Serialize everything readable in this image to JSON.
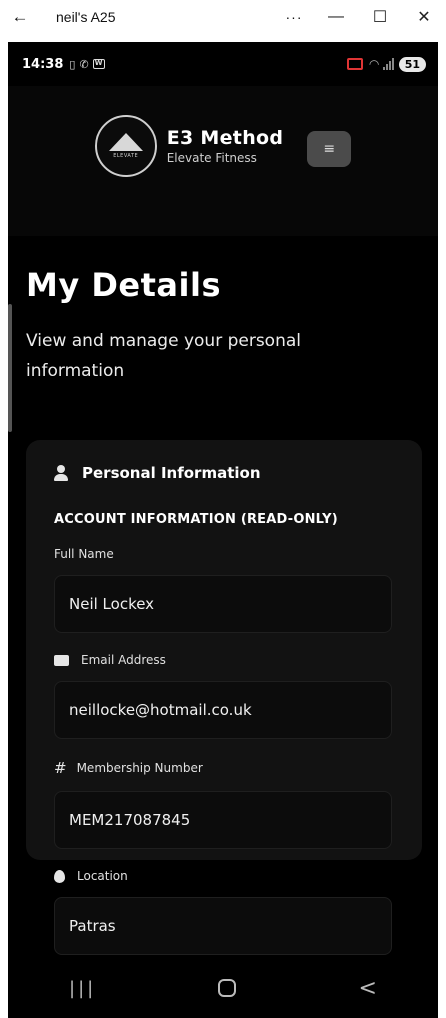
{
  "window": {
    "back_glyph": "←",
    "title": "neil's A25",
    "more_glyph": "···",
    "minimize_glyph": "—",
    "maximize_glyph": "☐",
    "close_glyph": "✕"
  },
  "status_bar": {
    "time": "14:38",
    "battery": "51"
  },
  "app_header": {
    "brand_name": "E3 Method",
    "brand_sub": "Elevate Fitness",
    "logo_text": "ELEVATE",
    "menu_glyph": "≡"
  },
  "page": {
    "title": "My Details",
    "subtitle": "View and manage your personal information"
  },
  "card": {
    "title": "Personal Information",
    "section_label": "ACCOUNT INFORMATION (READ-ONLY)",
    "fields": [
      {
        "label": "Full Name",
        "value": "Neil Lockex",
        "icon": ""
      },
      {
        "label": "Email Address",
        "value": "neillocke@hotmail.co.uk",
        "icon": "mail-icon"
      },
      {
        "label": "Membership Number",
        "value": "MEM217087845",
        "icon": "hash-icon"
      },
      {
        "label": "Location",
        "value": "Patras",
        "icon": "location-pin-icon"
      }
    ]
  },
  "navbar": {
    "recents_glyph": "|||",
    "back_glyph": "<"
  },
  "colors": {
    "background": "#000000",
    "card": "#121212",
    "menu_button": "#4b4b4b",
    "text": "#ffffff"
  }
}
